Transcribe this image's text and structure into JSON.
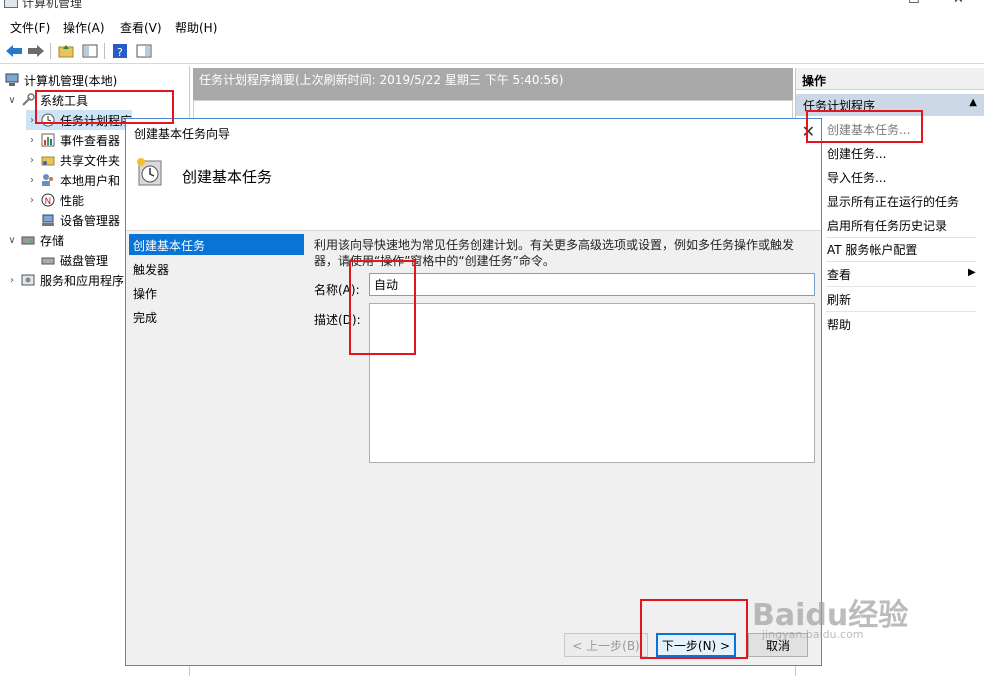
{
  "window": {
    "title": "计算机管理"
  },
  "menu": [
    "文件(F)",
    "操作(A)",
    "查看(V)",
    "帮助(H)"
  ],
  "tree": {
    "root": "计算机管理(本地)",
    "system_tools": "系统工具",
    "task_scheduler": "任务计划程序",
    "event_viewer": "事件查看器",
    "shared_folders": "共享文件夹",
    "local_users": "本地用户和",
    "performance": "性能",
    "device_manager": "设备管理器",
    "storage": "存储",
    "disk_management": "磁盘管理",
    "services_apps": "服务和应用程序"
  },
  "center": {
    "header": "任务计划程序摘要(上次刷新时间: 2019/5/22 星期三 下午 5:40:56)"
  },
  "actions": {
    "header": "操作",
    "section": "任务计划程序",
    "items": [
      "创建基本任务...",
      "创建任务...",
      "导入任务...",
      "显示所有正在运行的任务",
      "启用所有任务历史记录",
      "AT 服务帐户配置",
      "查看",
      "刷新",
      "帮助"
    ]
  },
  "dialog": {
    "title": "创建基本任务向导",
    "banner_title": "创建基本任务",
    "steps": [
      "创建基本任务",
      "触发器",
      "操作",
      "完成"
    ],
    "description": "利用该向导快速地为常见任务创建计划。有关更多高级选项或设置，例如多任务操作或触发器，请使用“操作”窗格中的“创建任务”命令。",
    "name_label": "名称(A):",
    "name_value": "自动",
    "desc_label": "描述(D):",
    "desc_value": "",
    "back_button": "< 上一步(B)",
    "next_button": "下一步(N) >",
    "cancel_button": "取消"
  },
  "watermark": {
    "logo": "Baidu经验",
    "url": "jingyan.baidu.com"
  }
}
